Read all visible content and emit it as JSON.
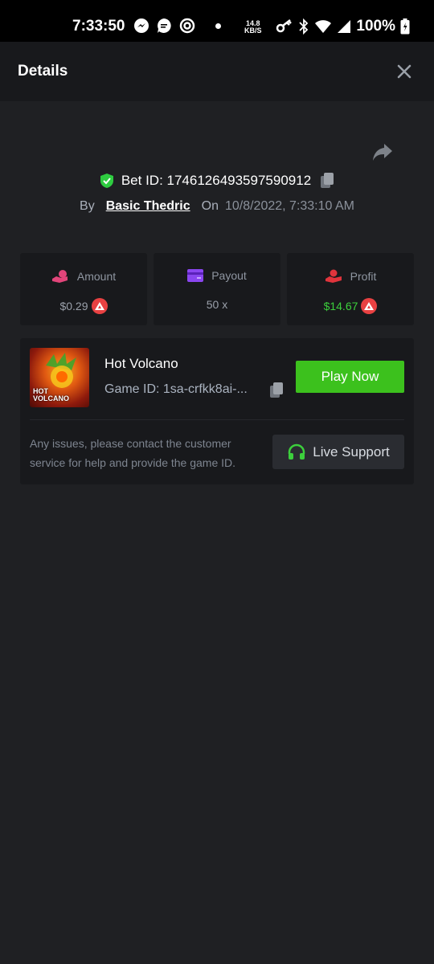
{
  "status_bar": {
    "time": "7:33:50",
    "net_speed": "14.8",
    "net_unit": "KB/S",
    "battery": "100%"
  },
  "header": {
    "title": "Details",
    "close_icon": "close-icon"
  },
  "bet": {
    "id_label": "Bet ID: 1746126493597590912",
    "by_label": "By",
    "user": "Basic Thedric",
    "on_label": "On",
    "date": "10/8/2022, 7:33:10 AM"
  },
  "stats": {
    "amount": {
      "label": "Amount",
      "value": "$0.29"
    },
    "payout": {
      "label": "Payout",
      "value": "50 x"
    },
    "profit": {
      "label": "Profit",
      "value": "$14.67"
    }
  },
  "game": {
    "thumb_line1": "HOT",
    "thumb_line2": "VOLCANO",
    "title": "Hot Volcano",
    "game_id": "Game ID: 1sa-crfkk8ai-...",
    "play_label": "Play Now",
    "help_text": "Any issues, please contact the customer service for help and provide the game ID.",
    "support_label": "Live Support"
  },
  "colors": {
    "background": "#1f2023",
    "panel": "#18191c",
    "play_green": "#3cc11d",
    "profit_green": "#3ccf3c",
    "coin_red": "#e84142"
  }
}
